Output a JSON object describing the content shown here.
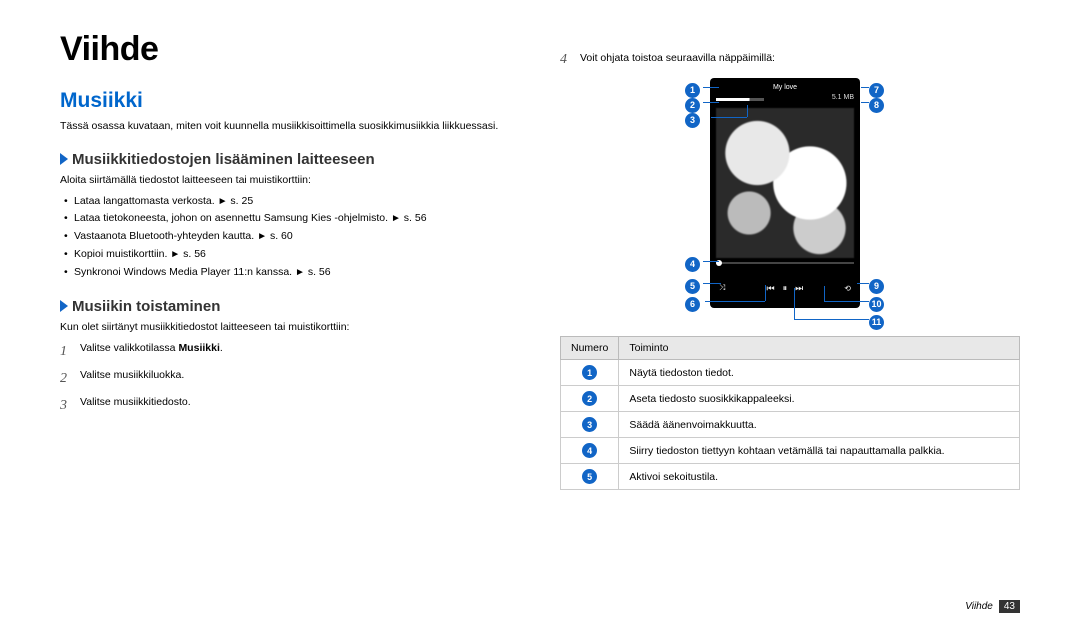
{
  "heading": "Viihde",
  "section": "Musiikki",
  "intro": "Tässä osassa kuvataan, miten voit kuunnella musiikkisoittimella suosikkimusiikkia liikkuessasi.",
  "sub1": {
    "title": "Musiikkitiedostojen lisääminen laitteeseen",
    "lead": "Aloita siirtämällä tiedostot laitteeseen tai muistikorttiin:",
    "bullets": [
      {
        "text": "Lataa langattomasta verkosta.",
        "ref": "s. 25"
      },
      {
        "text": "Lataa tietokoneesta, johon on asennettu Samsung Kies -ohjelmisto.",
        "ref": "s. 56"
      },
      {
        "text": "Vastaanota Bluetooth-yhteyden kautta.",
        "ref": "s. 60"
      },
      {
        "text": "Kopioi muistikorttiin.",
        "ref": "s. 56"
      },
      {
        "text": "Synkronoi Windows Media Player 11:n kanssa.",
        "ref": "s. 56"
      }
    ]
  },
  "sub2": {
    "title": "Musiikin toistaminen",
    "lead": "Kun olet siirtänyt musiikkitiedostot laitteeseen tai muistikorttiin:",
    "steps": {
      "s1_pre": "Valitse valikkotilassa ",
      "s1_bold": "Musiikki",
      "s1_post": ".",
      "s2": "Valitse musiikkiluokka.",
      "s3": "Valitse musiikkitiedosto.",
      "s4": "Voit ohjata toistoa seuraavilla näppäimillä:"
    }
  },
  "phone": {
    "title": "My love",
    "time_right": "5.1 MB"
  },
  "table": {
    "headers": {
      "num": "Numero",
      "func": "Toiminto"
    },
    "rows": [
      {
        "n": "1",
        "func": "Näytä tiedoston tiedot."
      },
      {
        "n": "2",
        "func": "Aseta tiedosto suosikkikappaleeksi."
      },
      {
        "n": "3",
        "func": "Säädä äänenvoimakkuutta."
      },
      {
        "n": "4",
        "func": "Siirry tiedoston tiettyyn kohtaan vetämällä tai napauttamalla palkkia."
      },
      {
        "n": "5",
        "func": "Aktivoi sekoitustila."
      }
    ]
  },
  "footer": {
    "section": "Viihde",
    "page": "43"
  }
}
